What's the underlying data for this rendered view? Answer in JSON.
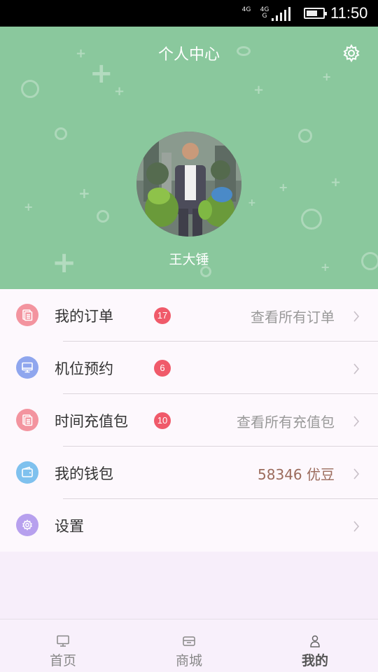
{
  "status_bar": {
    "network_1": "4G",
    "network_2": "4G\nG",
    "time": "11:50",
    "battery_level": 0.7
  },
  "header": {
    "title": "个人中心",
    "settings_icon": "gear-icon",
    "username": "王大锤",
    "background_color": "#8ac89d"
  },
  "menu": [
    {
      "label": "我的订单",
      "badge": "17",
      "value": "查看所有订单",
      "icon": "document-icon",
      "icon_color": "#f3949f"
    },
    {
      "label": "机位预约",
      "badge": "6",
      "value": "",
      "icon": "monitor-icon",
      "icon_color": "#8fa6ee"
    },
    {
      "label": "时间充值包",
      "badge": "10",
      "value": "查看所有充值包",
      "icon": "document-icon",
      "icon_color": "#f3949f"
    },
    {
      "label": "我的钱包",
      "badge": "",
      "value": "58346 优豆",
      "icon": "wallet-icon",
      "icon_color": "#7fc1ee"
    },
    {
      "label": "设置",
      "badge": "",
      "value": "",
      "icon": "gear-icon",
      "icon_color": "#b7a0ee"
    }
  ],
  "bottom_nav": [
    {
      "label": "首页",
      "icon": "monitor-icon",
      "active": false
    },
    {
      "label": "商城",
      "icon": "store-icon",
      "active": false
    },
    {
      "label": "我的",
      "icon": "person-icon",
      "active": true
    }
  ],
  "colors": {
    "accent": "#8ac89d",
    "badge": "#f05a6a",
    "wallet_value": "#9b6b5c"
  }
}
